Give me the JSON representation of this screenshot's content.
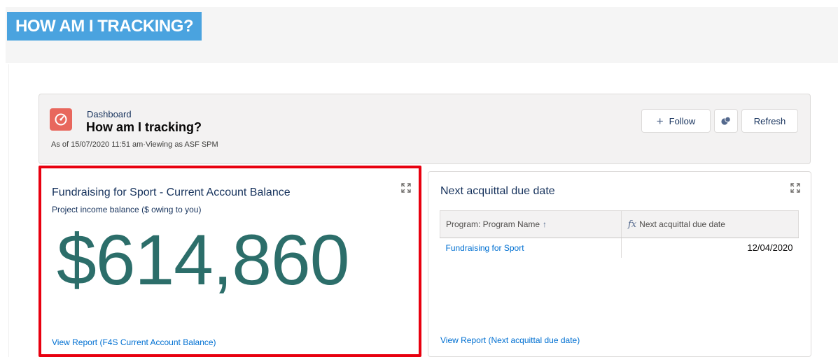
{
  "section": {
    "title": "HOW AM I TRACKING?"
  },
  "dashboard": {
    "label": "Dashboard",
    "title": "How am I tracking?",
    "subtitle": "As of 15/07/2020 11:51 am·Viewing as ASF SPM",
    "buttons": {
      "follow": "Follow",
      "refresh": "Refresh"
    }
  },
  "components": {
    "balance": {
      "title": "Fundraising for Sport - Current Account Balance",
      "subtitle": "Project income balance ($ owing to you)",
      "value": "$614,860",
      "view_report": "View Report (F4S Current Account Balance)"
    },
    "acquittal": {
      "title": "Next acquittal due date",
      "columns": [
        "Program: Program Name",
        "Next acquittal due date"
      ],
      "rows": [
        {
          "program": "Fundraising for Sport",
          "due_date": "12/04/2020"
        }
      ],
      "view_report": "View Report (Next acquittal due date)"
    }
  },
  "colors": {
    "section_banner": "#4aa3df",
    "metric": "#2c6e6a",
    "highlight_border": "#e8000f",
    "link": "#0070d2",
    "dashboard_icon": "#e8675d"
  }
}
